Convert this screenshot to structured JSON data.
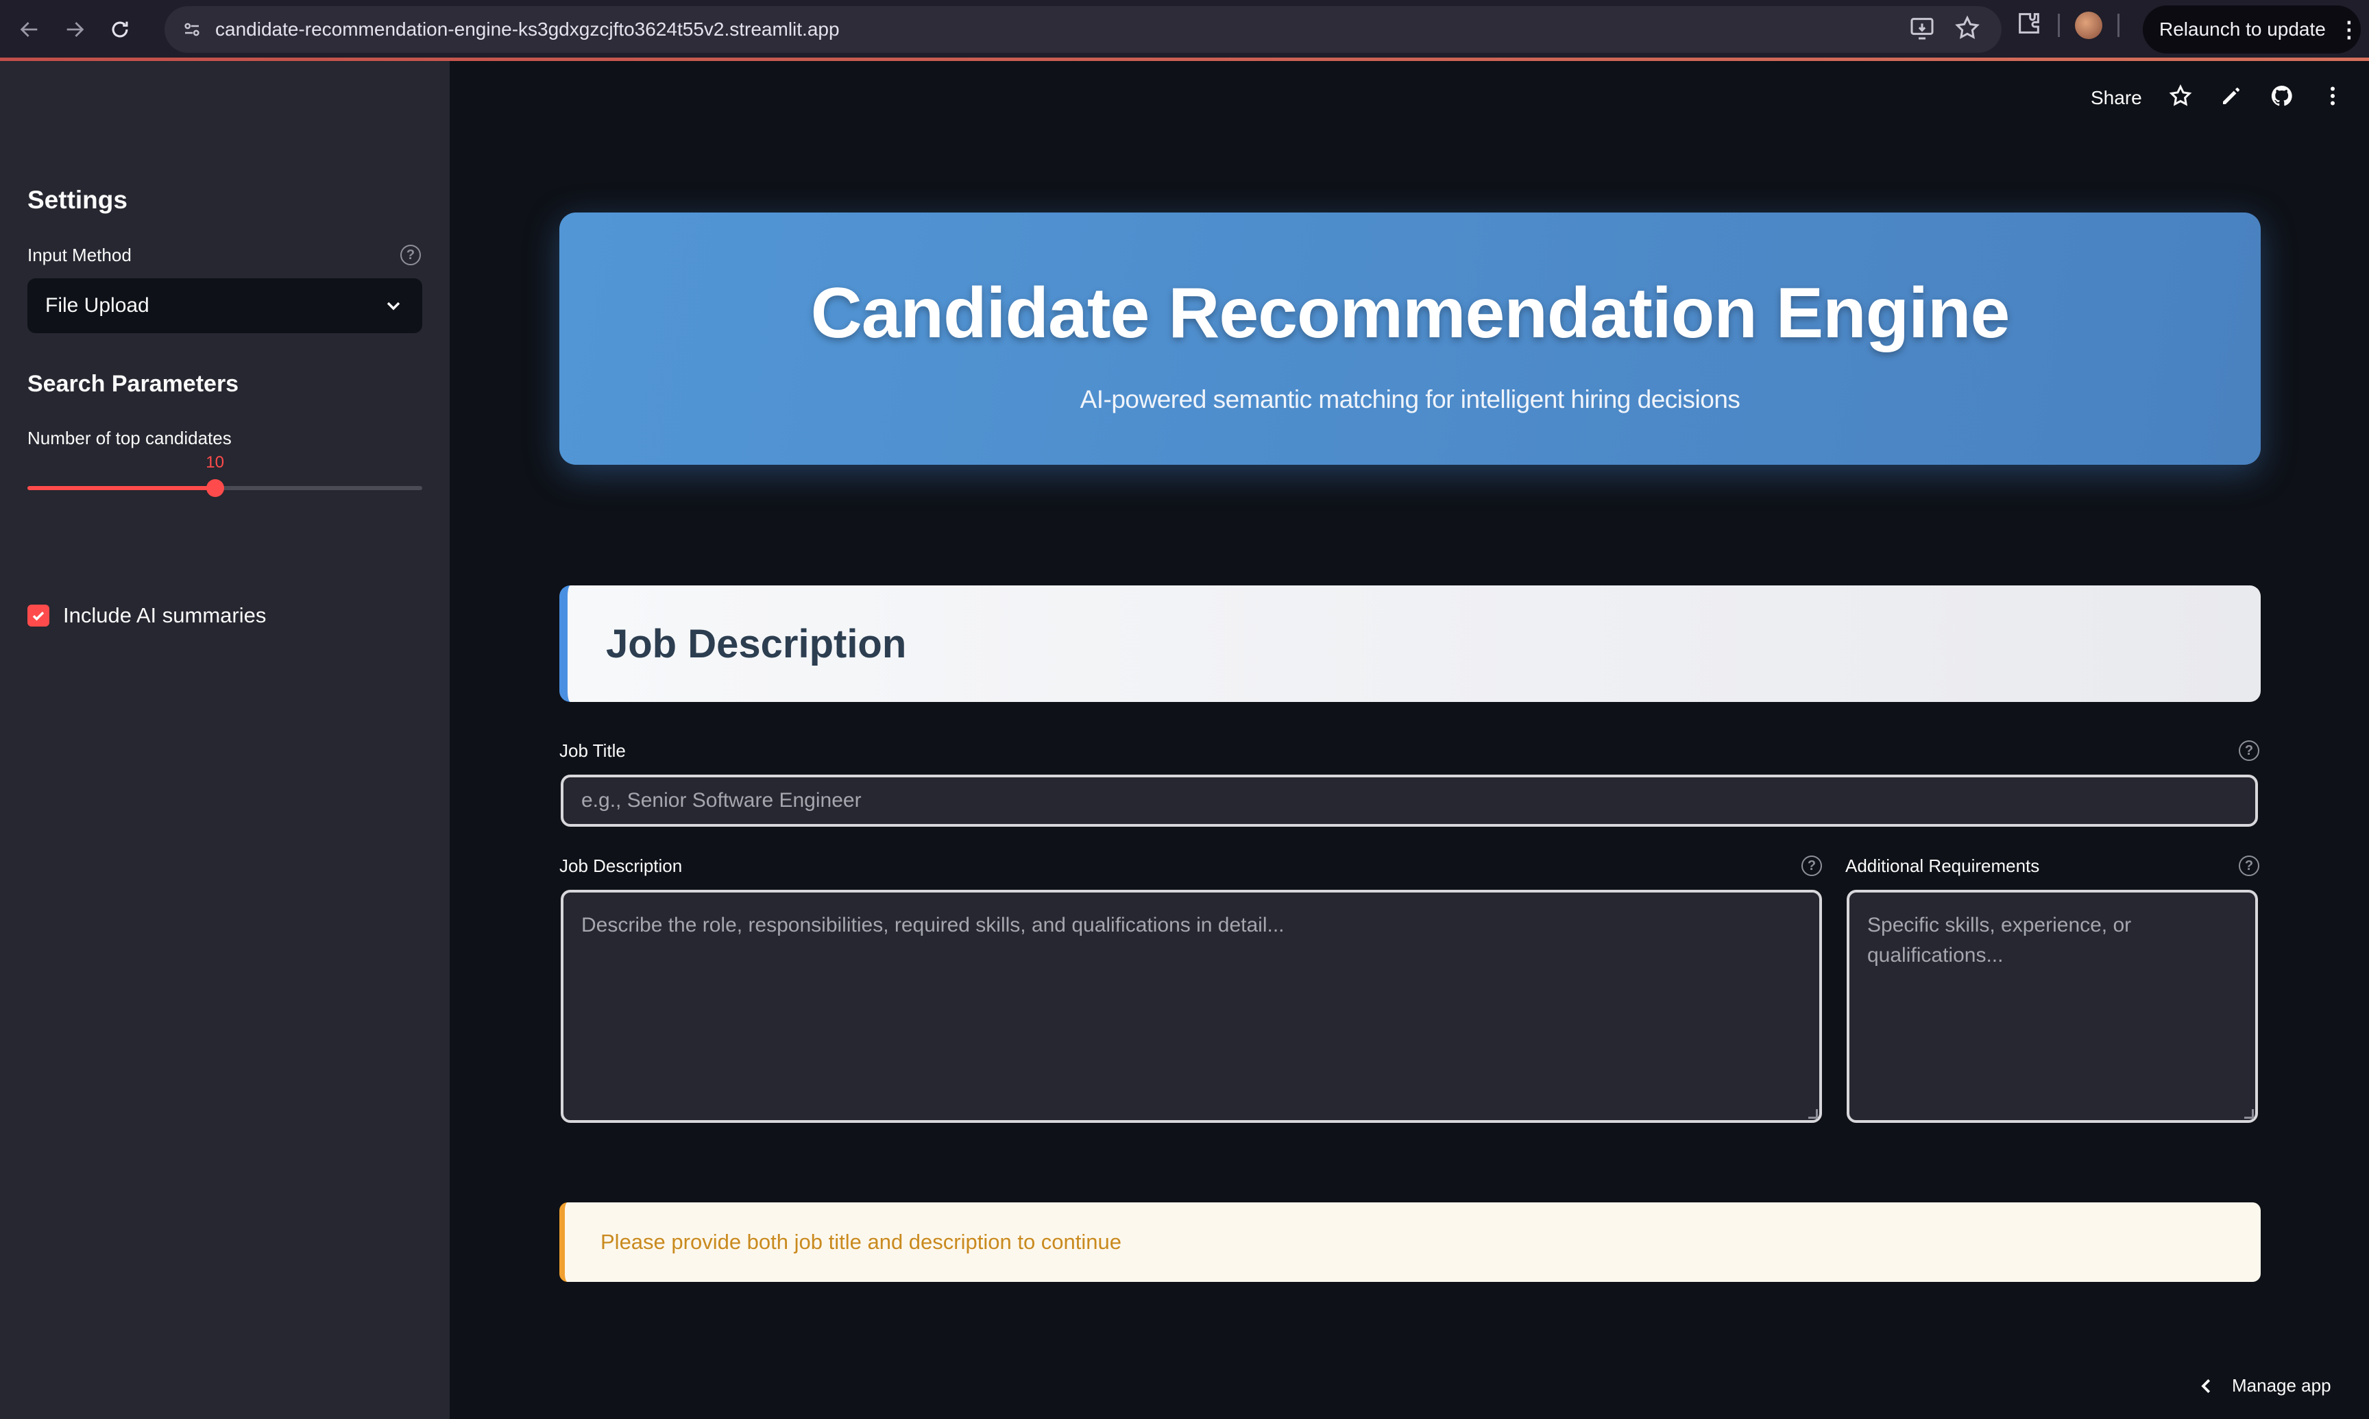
{
  "browser": {
    "url": "candidate-recommendation-engine-ks3gdxgzcjfto3624t55v2.streamlit.app",
    "relaunch_label": "Relaunch to update",
    "icons": [
      "back-arrow-icon",
      "forward-arrow-icon",
      "reload-icon",
      "site-settings-icon",
      "install-app-icon",
      "bookmark-star-icon",
      "extensions-icon",
      "profile-avatar",
      "more-vert-icon"
    ]
  },
  "sidebar": {
    "title": "Settings",
    "input_method": {
      "label": "Input Method",
      "value": "File Upload"
    },
    "search_params_title": "Search Parameters",
    "top_candidates": {
      "label": "Number of top candidates",
      "value": "10",
      "fraction": 0.475
    },
    "ai_summaries": {
      "label": "Include AI summaries",
      "checked": true
    }
  },
  "toolbar": {
    "share_label": "Share",
    "icons": [
      "star-icon",
      "edit-pencil-icon",
      "github-icon",
      "more-vert-icon"
    ]
  },
  "hero": {
    "title": "Candidate Recommendation Engine",
    "subtitle": "AI-powered semantic matching for intelligent hiring decisions"
  },
  "job_section": {
    "heading": "Job Description",
    "job_title": {
      "label": "Job Title",
      "placeholder": "e.g., Senior Software Engineer"
    },
    "job_description": {
      "label": "Job Description",
      "placeholder": "Describe the role, responsibilities, required skills, and qualifications in detail..."
    },
    "additional_requirements": {
      "label": "Additional Requirements",
      "placeholder": "Specific skills, experience, or qualifications..."
    }
  },
  "warning": {
    "text": "Please provide both job title and description to continue"
  },
  "footer": {
    "manage_label": "Manage app"
  },
  "colors": {
    "accent": "#ff4b4b",
    "hero_blue": "#4a90e2",
    "warning_text": "#c98a1e",
    "background": "#0e1117",
    "sidebar": "#262730"
  }
}
